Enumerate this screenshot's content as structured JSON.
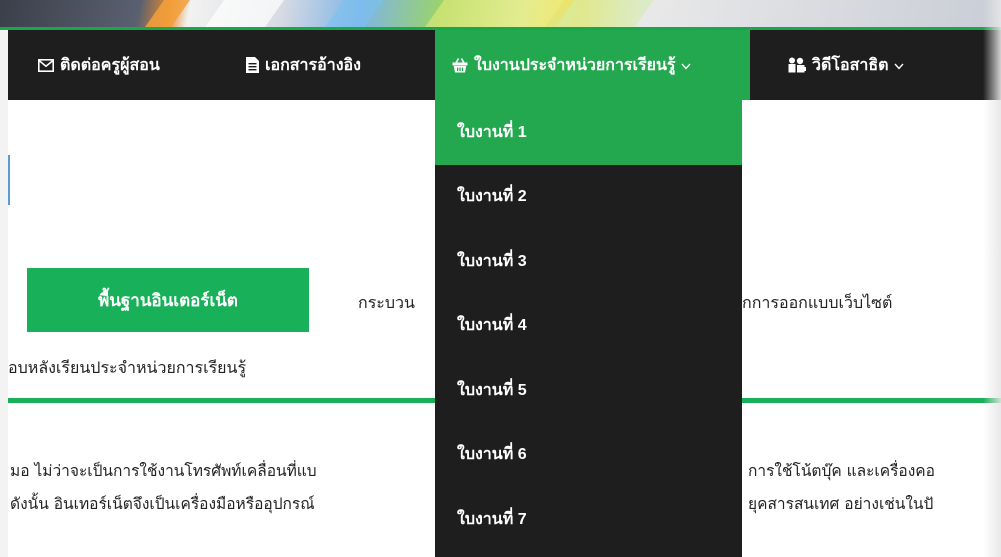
{
  "nav": {
    "contact": {
      "icon": "envelope-icon",
      "label": "ติดต่อครูผู้สอน"
    },
    "documents": {
      "icon": "document-icon",
      "label": "เอกสารอ้างอิง"
    },
    "worksheets": {
      "icon": "basket-icon",
      "label": "ใบงานประจำหน่วยการเรียนรู้",
      "caret": "⌄"
    },
    "video": {
      "icon": "video-demo-icon",
      "label": "วิดีโอสาธิต",
      "caret": "⌄"
    }
  },
  "dropdown": {
    "items": [
      {
        "label": "ใบงานที่ 1",
        "active": true
      },
      {
        "label": "ใบงานที่ 2"
      },
      {
        "label": "ใบงานที่ 3"
      },
      {
        "label": "ใบงานที่ 4"
      },
      {
        "label": "ใบงานที่ 5"
      },
      {
        "label": "ใบงานที่ 6"
      },
      {
        "label": "ใบงานที่ 7"
      }
    ]
  },
  "content": {
    "tabs": {
      "basic_internet": "พื้นฐานอินเตอร์เน็ต",
      "process": "กระบวน",
      "design": "ักการออกแบบเว็บไซต์",
      "post_test": "อบหลังเรียนประจำหน่วยการเรียนรู้"
    },
    "paragraph": {
      "line1_left": "มอ ไม่ว่าจะเป็นการใช้งานโทรศัพท์เคลื่อนที่แบ",
      "line1_right": "การใช้โน้ตบุ๊ค และเครื่องคอ",
      "line2_left": "ดังนั้น อินเทอร์เน็ตจึงเป็นเครื่องมือหรืออุปกรณ์",
      "line2_right": "ยุคสารสนเทศ อย่างเช่นในปั"
    }
  },
  "colors": {
    "nav_bg": "#1e1e1e",
    "accent_green": "#23a84f",
    "button_green": "#19b05a"
  }
}
